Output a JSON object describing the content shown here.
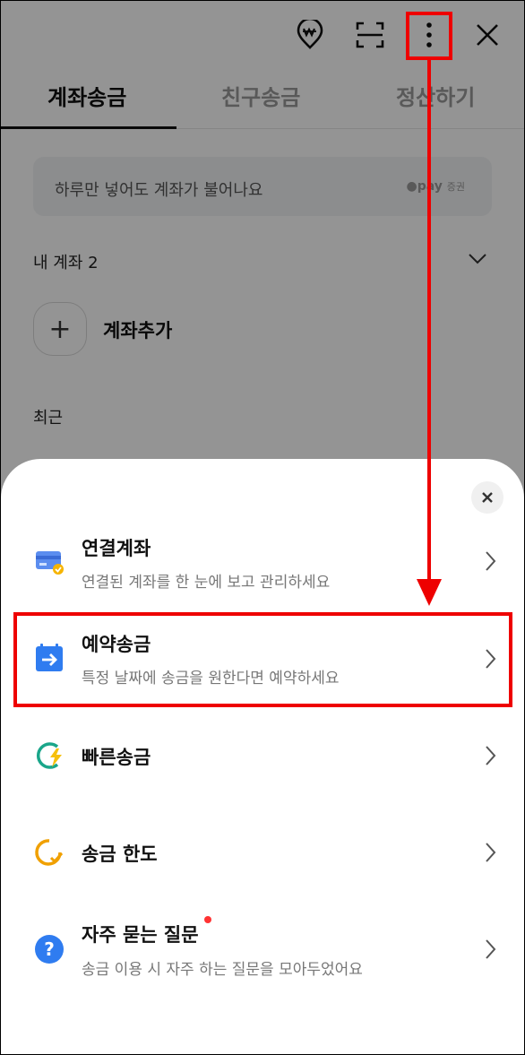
{
  "tabs": [
    {
      "label": "계좌송금",
      "active": true
    },
    {
      "label": "친구송금",
      "active": false
    },
    {
      "label": "정산하기",
      "active": false
    }
  ],
  "promo": {
    "text": "하루만 넣어도 계좌가 불어나요",
    "brand": "pay",
    "brand_sub": "증권"
  },
  "my_accounts": {
    "label": "내 계좌",
    "count": "2"
  },
  "add_account": {
    "label": "계좌추가"
  },
  "recent": {
    "label": "최근"
  },
  "sheet": {
    "items": [
      {
        "title": "연결계좌",
        "desc": "연결된 계좌를 한 눈에 보고 관리하세요",
        "icon": "linked-account-card-icon"
      },
      {
        "title": "예약송금",
        "desc": "특정 날짜에 송금을 원한다면 예약하세요",
        "icon": "scheduled-transfer-calendar-icon"
      },
      {
        "title": "빠른송금",
        "desc": "",
        "icon": "quick-transfer-bolt-icon"
      },
      {
        "title": "송금 한도",
        "desc": "",
        "icon": "transfer-limit-icon"
      },
      {
        "title": "자주 묻는 질문",
        "desc": "송금 이용 시 자주 하는 질문을 모아두었어요",
        "icon": "faq-question-icon"
      }
    ]
  },
  "colors": {
    "accent_blue": "#3a7ff0",
    "highlight_red": "#ee0000",
    "quick_green": "#1aa68a",
    "quick_yellow": "#f6c00c",
    "limit_orange": "#f0a000"
  }
}
